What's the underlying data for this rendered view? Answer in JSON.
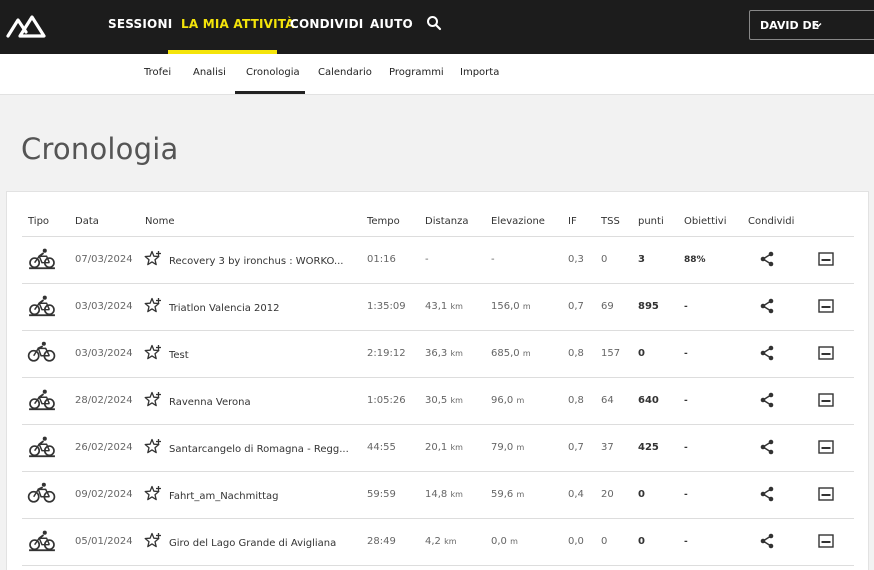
{
  "nav": {
    "items": [
      "SESSIONI",
      "LA MIA ATTIVITÀ",
      "CONDIVIDI",
      "AIUTO"
    ],
    "user_label": "DAVID DE"
  },
  "subnav": {
    "items": [
      "Trofei",
      "Analisi",
      "Cronologia",
      "Calendario",
      "Programmi",
      "Importa"
    ]
  },
  "page": {
    "title": "Cronologia"
  },
  "table": {
    "headers": [
      "Tipo",
      "Data",
      "Nome",
      "Tempo",
      "Distanza",
      "Elevazione",
      "IF",
      "TSS",
      "punti",
      "Obiettivi",
      "Condividi"
    ],
    "rows": [
      {
        "icon": "indoor-bike-icon",
        "date": "07/03/2024",
        "name": "Recovery 3 by ironchus : WORKO...",
        "time": "01:16",
        "distance": "-",
        "elevation": "-",
        "if": "0,3",
        "tss": "0",
        "points": "3",
        "goals": "88%"
      },
      {
        "icon": "indoor-bike-icon",
        "date": "03/03/2024",
        "name": "Triatlon Valencia 2012",
        "time": "1:35:09",
        "distance": "43,1",
        "distance_unit": "km",
        "elevation": "156,0",
        "elevation_unit": "m",
        "if": "0,7",
        "tss": "69",
        "points": "895",
        "goals": "-"
      },
      {
        "icon": "outdoor-bike-icon",
        "date": "03/03/2024",
        "name": "Test",
        "time": "2:19:12",
        "distance": "36,3",
        "distance_unit": "km",
        "elevation": "685,0",
        "elevation_unit": "m",
        "if": "0,8",
        "tss": "157",
        "points": "0",
        "goals": "-"
      },
      {
        "icon": "indoor-bike-icon",
        "date": "28/02/2024",
        "name": "Ravenna Verona",
        "time": "1:05:26",
        "distance": "30,5",
        "distance_unit": "km",
        "elevation": "96,0",
        "elevation_unit": "m",
        "if": "0,8",
        "tss": "64",
        "points": "640",
        "goals": "-"
      },
      {
        "icon": "indoor-bike-icon",
        "date": "26/02/2024",
        "name": "Santarcangelo di Romagna - Regg...",
        "time": "44:55",
        "distance": "20,1",
        "distance_unit": "km",
        "elevation": "79,0",
        "elevation_unit": "m",
        "if": "0,7",
        "tss": "37",
        "points": "425",
        "goals": "-"
      },
      {
        "icon": "outdoor-bike-icon",
        "date": "09/02/2024",
        "name": "Fahrt_am_Nachmittag",
        "time": "59:59",
        "distance": "14,8",
        "distance_unit": "km",
        "elevation": "59,6",
        "elevation_unit": "m",
        "if": "0,4",
        "tss": "20",
        "points": "0",
        "goals": "-"
      },
      {
        "icon": "indoor-bike-icon",
        "date": "05/01/2024",
        "name": "Giro del Lago Grande di Avigliana",
        "time": "28:49",
        "distance": "4,2",
        "distance_unit": "km",
        "elevation": "0,0",
        "elevation_unit": "m",
        "if": "0,0",
        "tss": "0",
        "points": "0",
        "goals": "-"
      }
    ]
  },
  "colors": {
    "topbar": "#1c1c1c",
    "accent": "#f4e40a",
    "background": "#f2f2f2"
  }
}
